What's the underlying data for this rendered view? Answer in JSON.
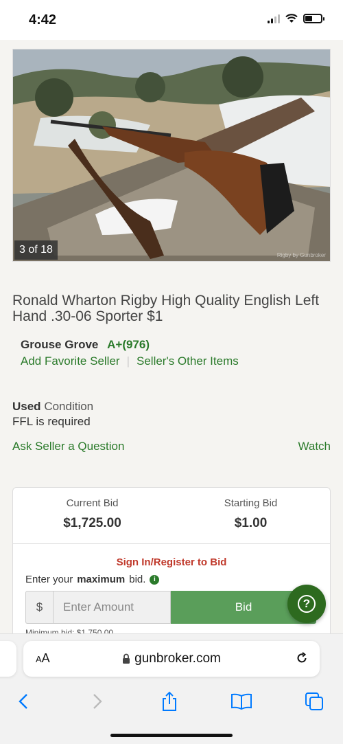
{
  "status_bar": {
    "time": "4:42"
  },
  "photo": {
    "counter": "3 of 18",
    "watermark": "Rigby by Gunbroker"
  },
  "listing": {
    "title": "Ronald Wharton Rigby High Quality English Left Hand .30-06 Sporter $1",
    "seller_name": "Grouse Grove",
    "seller_rating": "A+(976)",
    "add_favorite": "Add Favorite Seller",
    "other_items": "Seller's Other Items",
    "condition_value": "Used",
    "condition_label": "Condition",
    "ffl": "FFL is required",
    "ask_question": "Ask Seller a Question",
    "watch": "Watch"
  },
  "bid": {
    "current_label": "Current Bid",
    "current_value": "$1,725.00",
    "starting_label": "Starting Bid",
    "starting_value": "$1.00",
    "signin": "Sign In/Register to Bid",
    "enter_prefix": "Enter your",
    "enter_bold": "maximum",
    "enter_suffix": "bid.",
    "currency": "$",
    "amount_placeholder": "Enter Amount",
    "bid_button": "Bid",
    "minimum": "Minimum bid: $1,750.00"
  },
  "browser": {
    "aa_small": "A",
    "aa_large": "A",
    "domain": "gunbroker.com"
  },
  "colors": {
    "accent_green": "#2a7a2a",
    "bid_button": "#5a9e5a",
    "signin_red": "#c0392b",
    "help_button": "#2d6a1f",
    "ios_blue": "#007aff"
  }
}
